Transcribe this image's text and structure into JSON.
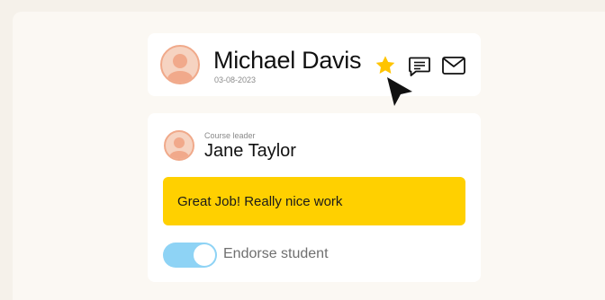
{
  "student": {
    "name": "Michael Davis",
    "date": "03-08-2023"
  },
  "actions": {
    "star_icon": "star-icon",
    "comment_icon": "comment-icon",
    "mail_icon": "mail-icon",
    "star_color": "#FFC400"
  },
  "leader": {
    "label": "Course leader",
    "name": "Jane Taylor"
  },
  "feedback": {
    "message": "Great Job! Really nice work",
    "background": "#FFD000"
  },
  "endorse": {
    "label": "Endorse student",
    "enabled": true,
    "toggle_color": "#8ED3F5"
  }
}
